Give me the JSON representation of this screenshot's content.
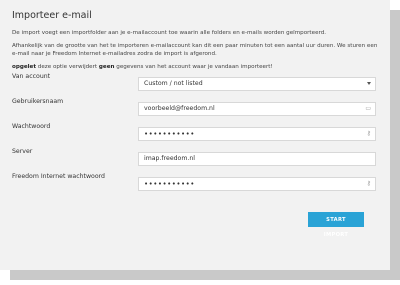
{
  "title": "Importeer e-mail",
  "intro": "De import voegt een importfolder aan je e-mailaccount toe waarin alle folders en e-mails worden geïmporteerd.",
  "duration": "Afhankelijk van de grootte van het te importeren e-mailaccount kan dit een paar minuten tot een aantal uur duren. We sturen een e-mail naar je Freedom Internet e-mailadres zodra de import is afgerond.",
  "warning": {
    "strong1": "opgelet",
    "text1": " deze optie verwijdert ",
    "strong2": "geen",
    "text2": " gegevens van het account waar je vandaan importeert!"
  },
  "fields": {
    "account": {
      "label": "Van account",
      "value": "Custom / not listed"
    },
    "username": {
      "label": "Gebruikersnaam",
      "value": "voorbeeld@freedom.nl"
    },
    "password": {
      "label": "Wachtwoord",
      "value": "•••••••••••"
    },
    "server": {
      "label": "Server",
      "value": "imap.freedom.nl"
    },
    "freedom_password": {
      "label": "Freedom Internet wachtwoord",
      "value": "•••••••••••"
    }
  },
  "submit_label": "START IMPORT",
  "icons": {
    "card": "id-card-icon",
    "key": "key-icon"
  }
}
